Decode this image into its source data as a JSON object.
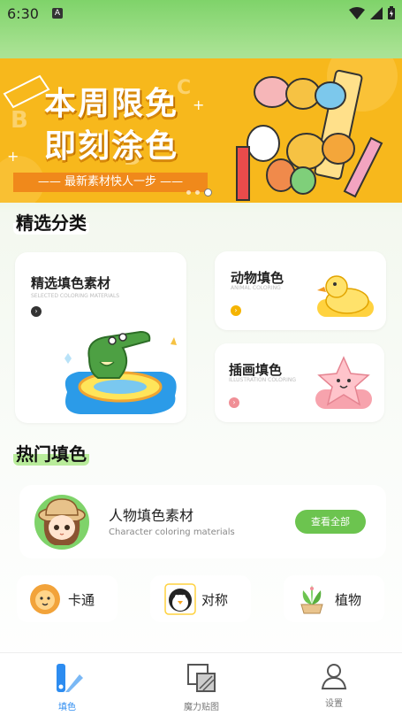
{
  "status": {
    "time": "6:30",
    "notif": "A"
  },
  "banner": {
    "line1": "本周限免",
    "line2": "即刻涂色",
    "subtitle": "—— 最新素材快人一步 ——",
    "page_count": 3,
    "active_page": 3
  },
  "featured": {
    "title": "精选分类",
    "cards": [
      {
        "title": "精选填色素材",
        "subtitle": "SELECTED COLORING MATERIALS",
        "arrow": "›",
        "color": "#333333"
      },
      {
        "title": "动物填色",
        "subtitle": "ANIMAL COLORING",
        "arrow": "›",
        "color": "#f5b400"
      },
      {
        "title": "插画填色",
        "subtitle": "ILLUSTRATION COLORING",
        "arrow": "›",
        "color": "#f08f96"
      }
    ]
  },
  "hot": {
    "title": "热门填色",
    "card": {
      "title": "人物填色素材",
      "subtitle": "Character coloring materials",
      "button": "查看全部"
    },
    "minis": [
      {
        "label": "卡通",
        "icon": "lion-icon"
      },
      {
        "label": "对称",
        "icon": "penguin-icon"
      },
      {
        "label": "植物",
        "icon": "plant-icon"
      }
    ]
  },
  "tabbar": {
    "tabs": [
      {
        "label": "填色",
        "active": true
      },
      {
        "label": "魔力贴图",
        "active": false
      },
      {
        "label": "设置",
        "active": false
      }
    ]
  },
  "colors": {
    "accent": "#6cc44f",
    "banner": "#f7b81c",
    "tab_active": "#2d8cf0",
    "tab_inactive": "#777777"
  }
}
